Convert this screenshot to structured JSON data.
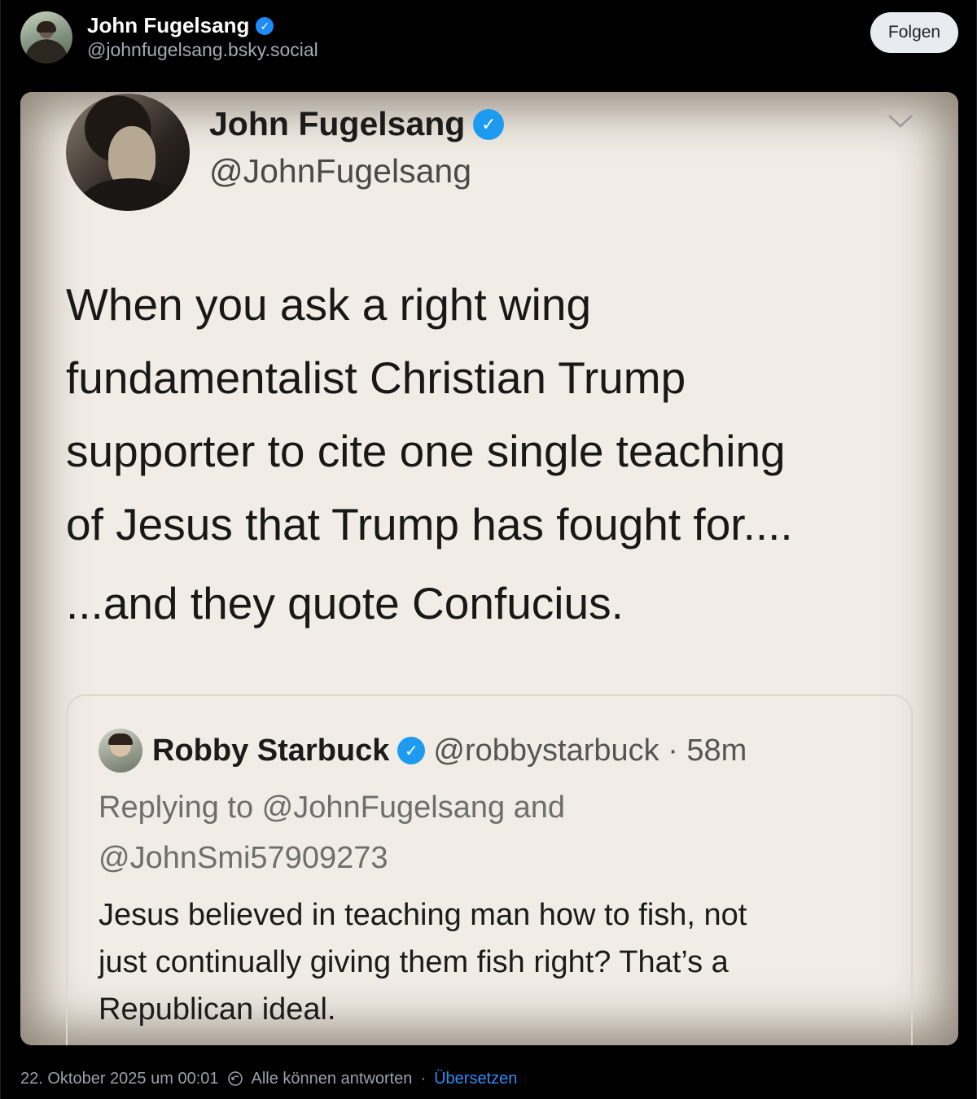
{
  "author": {
    "display_name": "John Fugelsang",
    "handle": "@johnfugelsang.bsky.social",
    "verified": true
  },
  "follow_button": {
    "label": "Folgen"
  },
  "embedded_tweet": {
    "author": {
      "name": "John Fugelsang",
      "handle": "@JohnFugelsang",
      "verified": true
    },
    "text_lines": [
      "When you ask a right wing",
      "fundamentalist Christian Trump",
      "supporter to cite one single teaching",
      "of Jesus that Trump has fought for...."
    ],
    "text_2": "...and they quote Confucius.",
    "quote": {
      "name": "Robby Starbuck",
      "handle_time": "@robbystarbuck · 58m",
      "reply_lines": [
        "Replying to @JohnFugelsang and",
        "@JohnSmi57909273"
      ],
      "body_lines": [
        "Jesus believed in teaching man how to fish, not",
        "just continually giving them fish right? That’s a",
        "Republican ideal."
      ]
    }
  },
  "meta": {
    "timestamp": "22. Oktober 2025 um 00:01",
    "reply_setting": "Alle können antworten",
    "separator": "·",
    "translate_label": "Übersetzen"
  },
  "colors": {
    "background": "#000000",
    "verified": "#1d8cf8",
    "link": "#2f8df6",
    "muted": "#9aa1ab"
  },
  "icons": [
    "verified-check-icon",
    "chevron-down-icon",
    "reply-settings-icon"
  ]
}
